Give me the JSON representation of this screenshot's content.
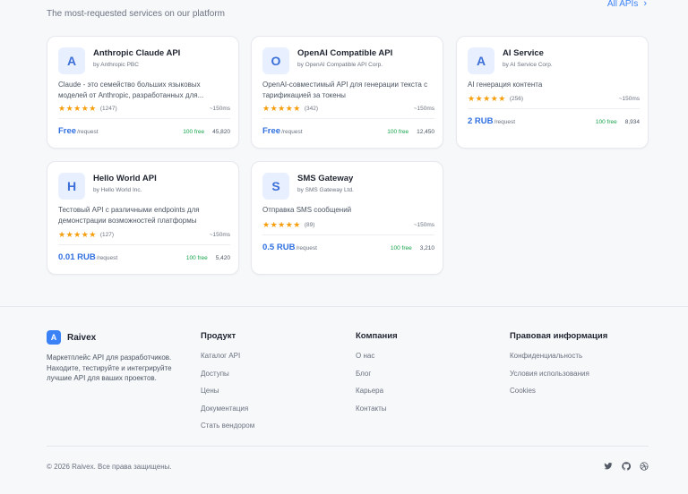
{
  "header": {
    "subtitle": "The most-requested services on our platform",
    "all_apis": "All APIs"
  },
  "cards": [
    {
      "initial": "A",
      "name": "Anthropic Claude API",
      "vendor": "by Anthropic PBC",
      "desc": "Claude - это семейство больших языковых моделей от Anthropic, разработанных для...",
      "stars": "★★★★★",
      "reviews": "(1247)",
      "latency": "~150ms",
      "price": "Free",
      "per": "/request",
      "free_tag": "100 free",
      "calls": "45,820"
    },
    {
      "initial": "O",
      "name": "OpenAI Compatible API",
      "vendor": "by OpenAI Compatible API Corp.",
      "desc": "OpenAI-совместимый API для генерации текста с тарификацией за токены",
      "stars": "★★★★★",
      "reviews": "(342)",
      "latency": "~150ms",
      "price": "Free",
      "per": "/request",
      "free_tag": "100 free",
      "calls": "12,450"
    },
    {
      "initial": "A",
      "name": "AI Service",
      "vendor": "by AI Service Corp.",
      "desc": "AI генерация контента",
      "stars": "★★★★★",
      "reviews": "(256)",
      "latency": "~150ms",
      "price": "2 RUB",
      "per": "/request",
      "free_tag": "100 free",
      "calls": "8,934"
    },
    {
      "initial": "H",
      "name": "Hello World API",
      "vendor": "by Hello World Inc.",
      "desc": "Тестовый API с различными endpoints для демонстрации возможностей платформы",
      "stars": "★★★★★",
      "reviews": "(127)",
      "latency": "~150ms",
      "price": "0.01 RUB",
      "per": "/request",
      "free_tag": "100 free",
      "calls": "5,420"
    },
    {
      "initial": "S",
      "name": "SMS Gateway",
      "vendor": "by SMS Gateway Ltd.",
      "desc": "Отправка SMS сообщений",
      "stars": "★★★★★",
      "reviews": "(89)",
      "latency": "~150ms",
      "price": "0.5 RUB",
      "per": "/request",
      "free_tag": "100 free",
      "calls": "3,210"
    }
  ],
  "footer": {
    "brand_initial": "A",
    "brand_name": "Raivex",
    "brand_desc": "Маркетплейс API для разработчиков. Находите, тестируйте и интегрируйте лучшие API для ваших проектов.",
    "columns": [
      {
        "title": "Продукт",
        "links": [
          "Каталог API",
          "Доступы",
          "Цены",
          "Документация",
          "Стать вендором"
        ]
      },
      {
        "title": "Компания",
        "links": [
          "О нас",
          "Блог",
          "Карьера",
          "Контакты"
        ]
      },
      {
        "title": "Правовая информация",
        "links": [
          "Конфиденциальность",
          "Условия использования",
          "Cookies"
        ]
      }
    ],
    "copyright": "© 2026 Raivex. Все права защищены.",
    "socials": [
      "twitter-icon",
      "github-icon",
      "dribbble-icon"
    ]
  }
}
